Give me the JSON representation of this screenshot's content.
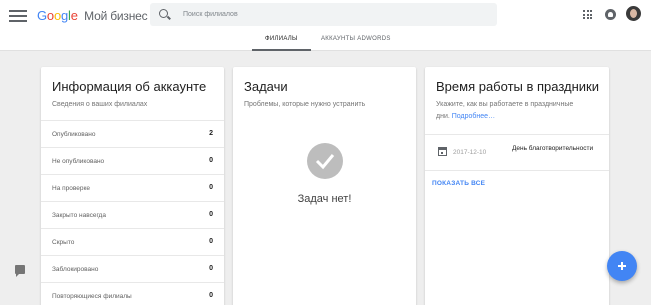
{
  "header": {
    "logo_letters": [
      "G",
      "o",
      "o",
      "g",
      "l",
      "e"
    ],
    "product": "Мой бизнес",
    "search_placeholder": "Поиск филиалов",
    "icons": [
      "menu-icon",
      "search-icon",
      "apps-icon",
      "notifications-icon",
      "avatar"
    ]
  },
  "tabs": [
    {
      "label": "ФИЛИАЛЫ",
      "active": true
    },
    {
      "label": "АККАУНТЫ ADWORDS",
      "active": false
    }
  ],
  "account_card": {
    "title": "Информация об аккаунте",
    "subtitle": "Сведения о ваших филиалах",
    "rows": [
      {
        "label": "Опубликовано",
        "value": "2"
      },
      {
        "label": "Не опубликовано",
        "value": "0"
      },
      {
        "label": "На проверке",
        "value": "0"
      },
      {
        "label": "Закрыто навсегда",
        "value": "0"
      },
      {
        "label": "Скрыто",
        "value": "0"
      },
      {
        "label": "Заблокировано",
        "value": "0"
      },
      {
        "label": "Повторяющиеся филиалы",
        "value": "0"
      }
    ]
  },
  "tasks_card": {
    "title": "Задачи",
    "subtitle": "Проблемы, которые нужно устранить",
    "empty_text": "Задач нет!"
  },
  "holidays_card": {
    "title": "Время работы в праздники",
    "subtitle": "Укажите, как вы работаете в праздничные",
    "subtitle_line2": "дни.",
    "more_link": "Подробнее…",
    "holiday": {
      "date": "2017-12-10",
      "name": "День благотворительности"
    },
    "show_all": "ПОКАЗАТЬ ВСЕ"
  },
  "colors": {
    "brand_blue": "#4285f4",
    "background": "#eeeeee"
  }
}
